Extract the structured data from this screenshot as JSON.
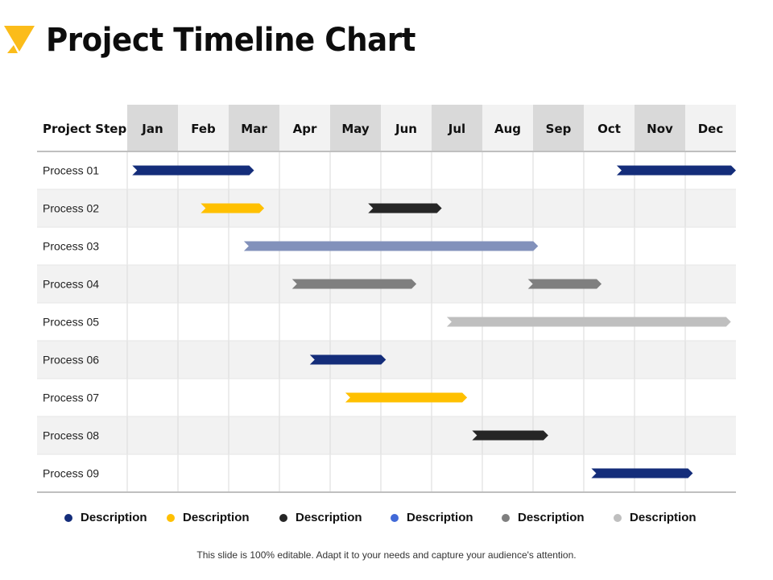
{
  "header": {
    "title": "Project Timeline Chart",
    "logo_icon": "yellow-triangle-logo-icon"
  },
  "chart_data": {
    "type": "gantt",
    "title": "Project Timeline Chart",
    "row_header": "Project Step",
    "categories": [
      "Jan",
      "Feb",
      "Mar",
      "Apr",
      "May",
      "Jun",
      "Jul",
      "Aug",
      "Sep",
      "Oct",
      "Nov",
      "Dec"
    ],
    "x_unit": "months from start of Jan",
    "xlim": [
      0,
      12
    ],
    "grid": true,
    "tasks": [
      {
        "name": "Process 01",
        "bars": [
          {
            "start": 0.1,
            "end": 2.5,
            "color": "#142d7a"
          },
          {
            "start": 9.65,
            "end": 12.0,
            "color": "#142d7a"
          }
        ]
      },
      {
        "name": "Process 02",
        "bars": [
          {
            "start": 1.45,
            "end": 2.7,
            "color": "#ffc000"
          },
          {
            "start": 4.75,
            "end": 6.2,
            "color": "#262626"
          }
        ]
      },
      {
        "name": "Process 03",
        "bars": [
          {
            "start": 2.3,
            "end": 8.1,
            "color": "#8291bb"
          }
        ]
      },
      {
        "name": "Process 04",
        "bars": [
          {
            "start": 3.25,
            "end": 5.7,
            "color": "#7f7f7f"
          },
          {
            "start": 7.9,
            "end": 9.35,
            "color": "#7f7f7f"
          }
        ]
      },
      {
        "name": "Process 05",
        "bars": [
          {
            "start": 6.3,
            "end": 11.9,
            "color": "#bfbfbf"
          }
        ]
      },
      {
        "name": "Process 06",
        "bars": [
          {
            "start": 3.6,
            "end": 5.1,
            "color": "#142d7a"
          }
        ]
      },
      {
        "name": "Process 07",
        "bars": [
          {
            "start": 4.3,
            "end": 6.7,
            "color": "#ffc000"
          }
        ]
      },
      {
        "name": "Process 08",
        "bars": [
          {
            "start": 6.8,
            "end": 8.3,
            "color": "#262626"
          }
        ]
      },
      {
        "name": "Process 09",
        "bars": [
          {
            "start": 9.15,
            "end": 11.15,
            "color": "#142d7a"
          }
        ]
      }
    ],
    "legend": [
      {
        "label": "Description",
        "color": "#142d7a"
      },
      {
        "label": "Description",
        "color": "#ffc000"
      },
      {
        "label": "Description",
        "color": "#262626"
      },
      {
        "label": "Description",
        "color": "#4169d8"
      },
      {
        "label": "Description",
        "color": "#7f7f7f"
      },
      {
        "label": "Description",
        "color": "#bfbfbf"
      }
    ],
    "legend_position": "bottom"
  },
  "colors": {
    "accent": "#fbbc1a",
    "header_dark_cell": "#d9d9d9",
    "header_light_cell": "#f2f2f2",
    "row_alt": "#f2f2f2",
    "grid": "#d9d9d9"
  },
  "footer": {
    "text": "This slide is 100% editable. Adapt it to your needs and capture your audience's attention."
  }
}
